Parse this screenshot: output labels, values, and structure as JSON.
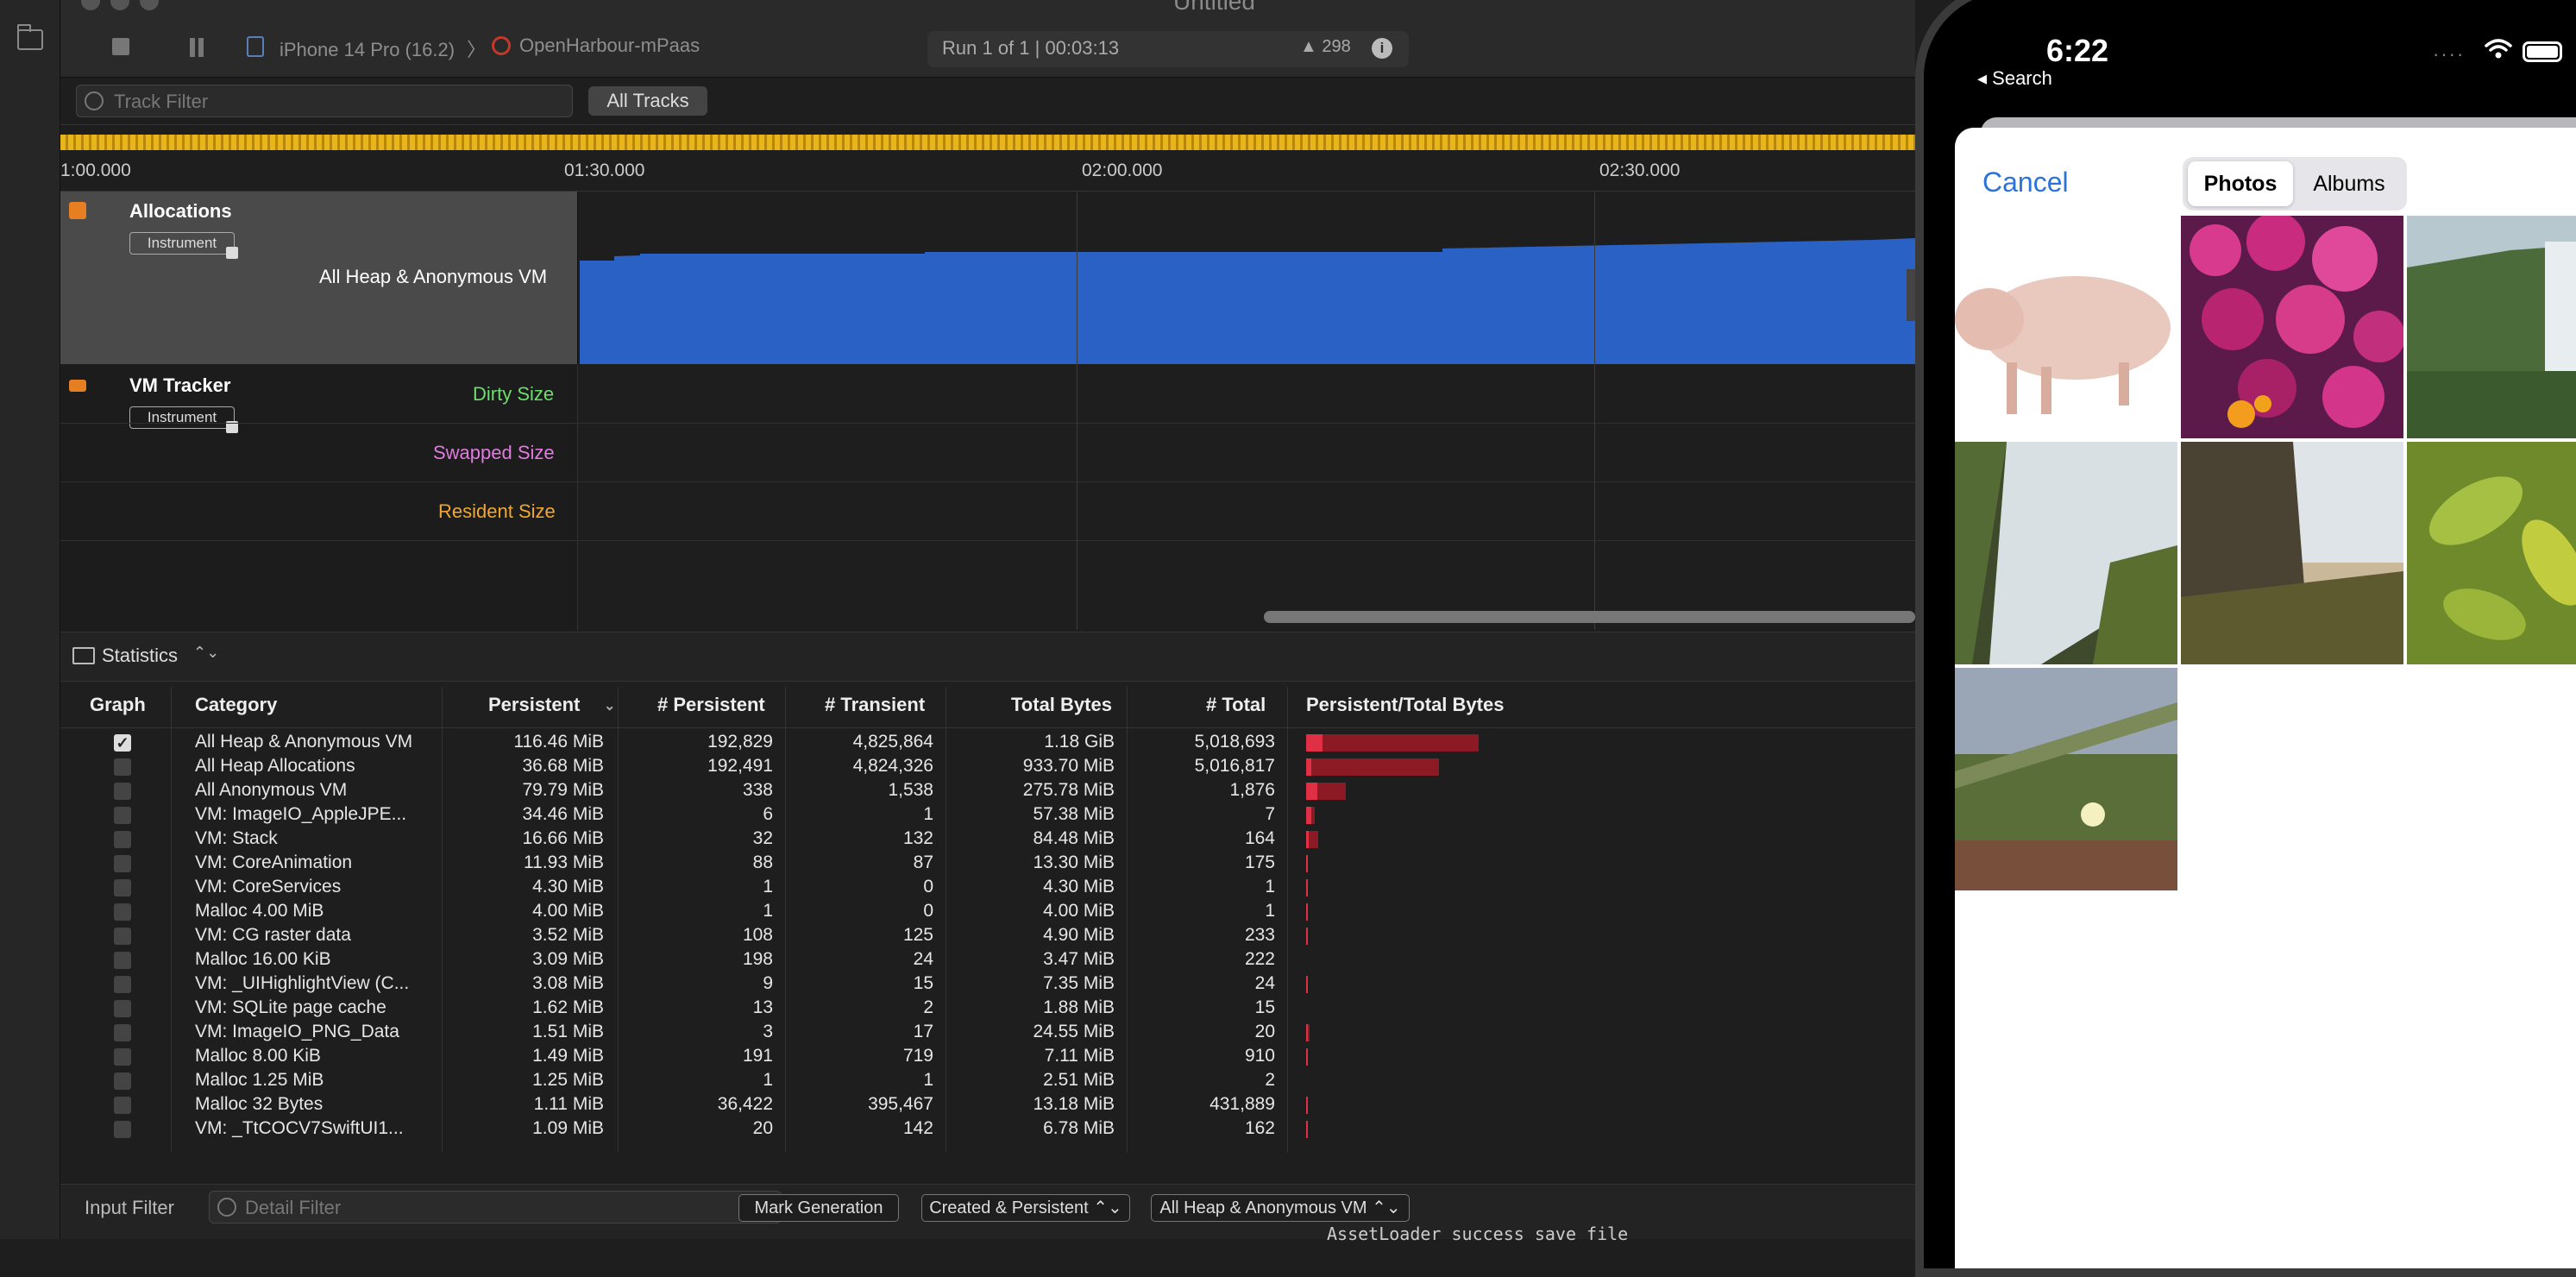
{
  "window": {
    "title": "Untitled"
  },
  "toolbar": {
    "device": "iPhone 14 Pro (16.2)",
    "separator": "〉",
    "app": "OpenHarbour-mPaas",
    "run_status": "Run 1 of 1  |  00:03:13",
    "warnings": "▲ 298",
    "info": "i"
  },
  "filter": {
    "track_filter_placeholder": "Track Filter",
    "all_tracks": "All Tracks"
  },
  "timeline": {
    "ticks": [
      "1:00.000",
      "01:30.000",
      "02:00.000",
      "02:30.000"
    ]
  },
  "tracks": {
    "allocations": {
      "name": "Allocations",
      "badge": "Instrument",
      "subtrack": "All Heap & Anonymous VM",
      "color": "#2962c4"
    },
    "vm": {
      "name": "VM Tracker",
      "badge": "Instrument",
      "dirty": "Dirty Size",
      "swapped": "Swapped Size",
      "resident": "Resident Size"
    }
  },
  "stats": {
    "label": "Statistics",
    "chevron": "⌃⌄"
  },
  "table": {
    "headers": {
      "graph": "Graph",
      "category": "Category",
      "persistent": "Persistent",
      "n_persistent": "# Persistent",
      "n_transient": "# Transient",
      "total_bytes": "Total Bytes",
      "n_total": "# Total",
      "ratio": "Persistent/Total Bytes"
    },
    "rows": [
      {
        "checked": true,
        "category": "All Heap & Anonymous VM",
        "persistent": "116.46 MiB",
        "n_persistent": "192,829",
        "n_transient": "4,825,864",
        "total_bytes": "1.18 GiB",
        "n_total": "5,018,693",
        "ratio": 0.096,
        "total_frac": 1.0
      },
      {
        "checked": false,
        "category": "All Heap Allocations",
        "persistent": "36.68 MiB",
        "n_persistent": "192,491",
        "n_transient": "4,824,326",
        "total_bytes": "933.70 MiB",
        "n_total": "5,016,817",
        "ratio": 0.039,
        "total_frac": 0.77
      },
      {
        "checked": false,
        "category": "All Anonymous VM",
        "persistent": "79.79 MiB",
        "n_persistent": "338",
        "n_transient": "1,538",
        "total_bytes": "275.78 MiB",
        "n_total": "1,876",
        "ratio": 0.29,
        "total_frac": 0.23
      },
      {
        "checked": false,
        "category": "VM: ImageIO_AppleJPE...",
        "persistent": "34.46 MiB",
        "n_persistent": "6",
        "n_transient": "1",
        "total_bytes": "57.38 MiB",
        "n_total": "7",
        "ratio": 0.6,
        "total_frac": 0.05
      },
      {
        "checked": false,
        "category": "VM: Stack",
        "persistent": "16.66 MiB",
        "n_persistent": "32",
        "n_transient": "132",
        "total_bytes": "84.48 MiB",
        "n_total": "164",
        "ratio": 0.2,
        "total_frac": 0.07
      },
      {
        "checked": false,
        "category": "VM: CoreAnimation",
        "persistent": "11.93 MiB",
        "n_persistent": "88",
        "n_transient": "87",
        "total_bytes": "13.30 MiB",
        "n_total": "175",
        "ratio": 0.9,
        "total_frac": 0.011
      },
      {
        "checked": false,
        "category": "VM: CoreServices",
        "persistent": "4.30 MiB",
        "n_persistent": "1",
        "n_transient": "0",
        "total_bytes": "4.30 MiB",
        "n_total": "1",
        "ratio": 1.0,
        "total_frac": 0.0036
      },
      {
        "checked": false,
        "category": "Malloc 4.00 MiB",
        "persistent": "4.00 MiB",
        "n_persistent": "1",
        "n_transient": "0",
        "total_bytes": "4.00 MiB",
        "n_total": "1",
        "ratio": 1.0,
        "total_frac": 0.0033
      },
      {
        "checked": false,
        "category": "VM: CG raster data",
        "persistent": "3.52 MiB",
        "n_persistent": "108",
        "n_transient": "125",
        "total_bytes": "4.90 MiB",
        "n_total": "233",
        "ratio": 0.72,
        "total_frac": 0.004
      },
      {
        "checked": false,
        "category": "Malloc 16.00 KiB",
        "persistent": "3.09 MiB",
        "n_persistent": "198",
        "n_transient": "24",
        "total_bytes": "3.47 MiB",
        "n_total": "222",
        "ratio": 0.89,
        "total_frac": 0.0029
      },
      {
        "checked": false,
        "category": "VM: _UIHighlightView (C...",
        "persistent": "3.08 MiB",
        "n_persistent": "9",
        "n_transient": "15",
        "total_bytes": "7.35 MiB",
        "n_total": "24",
        "ratio": 0.42,
        "total_frac": 0.006
      },
      {
        "checked": false,
        "category": "VM: SQLite page cache",
        "persistent": "1.62 MiB",
        "n_persistent": "13",
        "n_transient": "2",
        "total_bytes": "1.88 MiB",
        "n_total": "15",
        "ratio": 0.86,
        "total_frac": 0.0016
      },
      {
        "checked": false,
        "category": "VM: ImageIO_PNG_Data",
        "persistent": "1.51 MiB",
        "n_persistent": "3",
        "n_transient": "17",
        "total_bytes": "24.55 MiB",
        "n_total": "20",
        "ratio": 0.06,
        "total_frac": 0.02
      },
      {
        "checked": false,
        "category": "Malloc 8.00 KiB",
        "persistent": "1.49 MiB",
        "n_persistent": "191",
        "n_transient": "719",
        "total_bytes": "7.11 MiB",
        "n_total": "910",
        "ratio": 0.21,
        "total_frac": 0.006
      },
      {
        "checked": false,
        "category": "Malloc 1.25 MiB",
        "persistent": "1.25 MiB",
        "n_persistent": "1",
        "n_transient": "1",
        "total_bytes": "2.51 MiB",
        "n_total": "2",
        "ratio": 0.5,
        "total_frac": 0.002
      },
      {
        "checked": false,
        "category": "Malloc 32 Bytes",
        "persistent": "1.11 MiB",
        "n_persistent": "36,422",
        "n_transient": "395,467",
        "total_bytes": "13.18 MiB",
        "n_total": "431,889",
        "ratio": 0.08,
        "total_frac": 0.011
      },
      {
        "checked": false,
        "category": "VM: _TtCOCV7SwiftUI1...",
        "persistent": "1.09 MiB",
        "n_persistent": "20",
        "n_transient": "142",
        "total_bytes": "6.78 MiB",
        "n_total": "162",
        "ratio": 0.16,
        "total_frac": 0.0056
      }
    ]
  },
  "bottom": {
    "input_filter": "Input Filter",
    "detail_filter_placeholder": "Detail Filter",
    "mark_generation": "Mark Generation",
    "mode": "Created & Persistent ⌃⌄",
    "scope": "All Heap & Anonymous VM ⌃⌄",
    "console": "AssetLoader success save file"
  },
  "phone": {
    "time": "6:22",
    "back": "◂ Search",
    "dots": "····",
    "cancel": "Cancel",
    "tabs": {
      "photos": "Photos",
      "albums": "Albums"
    }
  }
}
